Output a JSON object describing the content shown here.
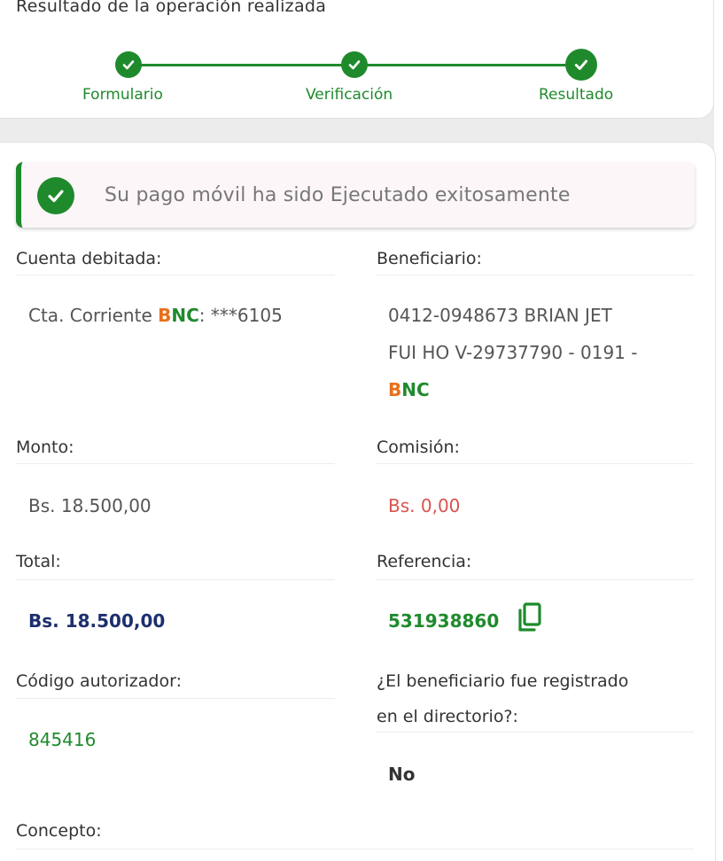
{
  "header": {
    "title": "Resultado de la operación realizada",
    "steps": [
      {
        "label": "Formulario"
      },
      {
        "label": "Verificación"
      },
      {
        "label": "Resultado"
      }
    ]
  },
  "alert": {
    "message": "Su pago móvil ha sido Ejecutado exitosamente"
  },
  "fields": {
    "cuenta_debitada": {
      "label": "Cuenta debitada:",
      "prefix": "Cta. Corriente ",
      "bank_b": "B",
      "bank_nc": "NC",
      "suffix": ": ***6105"
    },
    "beneficiario": {
      "label": "Beneficiario:",
      "line1": "0412-0948673 BRIAN JET",
      "line2": "FUI HO V-29737790 - 0191 -",
      "bank_b": "B",
      "bank_nc": "NC"
    },
    "monto": {
      "label": "Monto:",
      "value": "Bs. 18.500,00"
    },
    "comision": {
      "label": "Comisión:",
      "value": "Bs. 0,00"
    },
    "total": {
      "label": "Total:",
      "value": "Bs. 18.500,00"
    },
    "referencia": {
      "label": "Referencia:",
      "value": "531938860"
    },
    "codigo": {
      "label": "Código autorizador:",
      "value": "845416"
    },
    "registrado": {
      "label_line1": "¿El beneficiario fue registrado",
      "label_line2": "en el directorio?:",
      "value": "No"
    },
    "concepto": {
      "label": "Concepto:"
    }
  },
  "colors": {
    "brand_green": "#1f8a2c",
    "bnc_orange": "#e8701a",
    "total_navy": "#1c2f6e",
    "commission_red": "#d9534f"
  },
  "icons": {
    "step_check": "check-icon",
    "alert": "check-circle-icon",
    "copy": "copy-icon"
  }
}
